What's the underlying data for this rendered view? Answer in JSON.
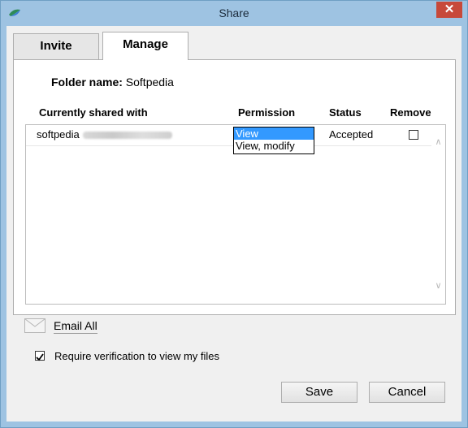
{
  "window": {
    "title": "Share",
    "close_label": "✕"
  },
  "tabs": [
    {
      "label": "Invite"
    },
    {
      "label": "Manage"
    }
  ],
  "folder": {
    "label": "Folder name:",
    "value": "Softpedia"
  },
  "columns": {
    "shared_with": "Currently shared with",
    "permission": "Permission",
    "status": "Status",
    "remove": "Remove"
  },
  "rows": [
    {
      "user": "softpedia",
      "permission": "View",
      "status": "Accepted",
      "remove": false
    }
  ],
  "permission_options": [
    "View",
    "View, modify"
  ],
  "email_all": "Email All",
  "verification": {
    "label": "Require verification to view my files",
    "checked": true
  },
  "buttons": {
    "save": "Save",
    "cancel": "Cancel"
  },
  "icons": {
    "app": "share-app-icon",
    "email": "envelope-icon",
    "scroll_up": "chevron-up-icon",
    "scroll_down": "chevron-down-icon"
  }
}
